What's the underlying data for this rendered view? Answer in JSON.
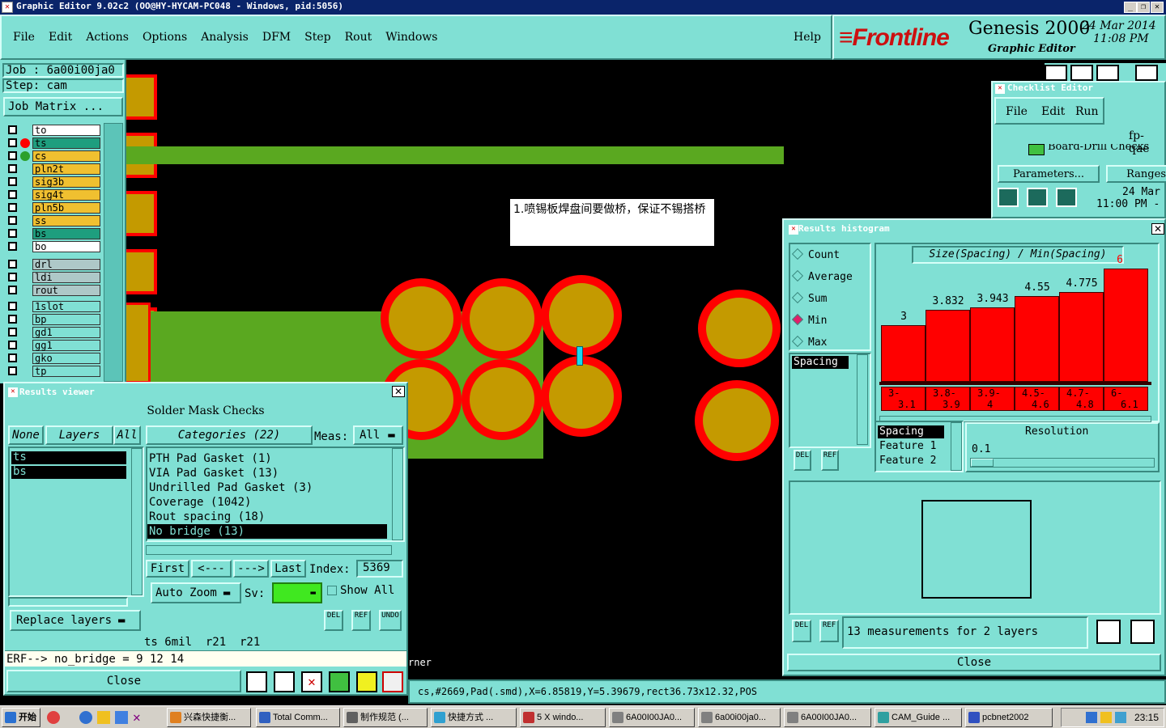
{
  "window": {
    "title": "Graphic Editor 9.02c2  (OO@HY-HYCAM-PC048 - Windows, pid:5056)"
  },
  "menu": [
    "File",
    "Edit",
    "Actions",
    "Options",
    "Analysis",
    "DFM",
    "Step",
    "Rout",
    "Windows"
  ],
  "help_label": "Help",
  "brand": {
    "logo": "Frontline",
    "product": "Genesis 2000",
    "subtitle": "Graphic Editor",
    "date": "24 Mar 2014",
    "time": "11:08 PM"
  },
  "job": {
    "job_line": "Job :  6a00i00ja0",
    "step_line": "Step:  cam",
    "matrix_button": "Job Matrix ..."
  },
  "layers": [
    {
      "name": "to",
      "color": "#ffffff",
      "dot": ""
    },
    {
      "name": "ts",
      "color": "#1e9e7e",
      "dot": "#ff0000"
    },
    {
      "name": "cs",
      "color": "#f0c030",
      "dot": "#2ca02c"
    },
    {
      "name": "pln2t",
      "color": "#f0c030",
      "dot": ""
    },
    {
      "name": "sig3b",
      "color": "#f0c030",
      "dot": ""
    },
    {
      "name": "sig4t",
      "color": "#f0c030",
      "dot": ""
    },
    {
      "name": "pln5b",
      "color": "#f0c030",
      "dot": ""
    },
    {
      "name": "ss",
      "color": "#f0c030",
      "dot": ""
    },
    {
      "name": "bs",
      "color": "#1e9e7e",
      "dot": ""
    },
    {
      "name": "bo",
      "color": "#ffffff",
      "dot": ""
    },
    {
      "name": "drl",
      "color": "#aec8c8",
      "dot": ""
    },
    {
      "name": "ldi",
      "color": "#aec8c8",
      "dot": ""
    },
    {
      "name": "rout",
      "color": "#aec8c8",
      "dot": ""
    },
    {
      "name": "1slot",
      "color": "#80e0d4",
      "dot": ""
    },
    {
      "name": "bp",
      "color": "#80e0d4",
      "dot": ""
    },
    {
      "name": "gd1",
      "color": "#80e0d4",
      "dot": ""
    },
    {
      "name": "gg1",
      "color": "#80e0d4",
      "dot": ""
    },
    {
      "name": "gko",
      "color": "#80e0d4",
      "dot": ""
    },
    {
      "name": "tp",
      "color": "#80e0d4",
      "dot": ""
    }
  ],
  "annotation": "1.喷锡板焊盘间要做桥，保证不锡搭桥",
  "results_viewer": {
    "title": "Results viewer",
    "heading": "Solder Mask Checks",
    "none_btn": "None",
    "layers_btn": "Layers",
    "all_btn": "All",
    "categories_btn": "Categories (22)",
    "meas_label": "Meas:",
    "meas_value": "All",
    "layer_list": [
      "ts",
      "bs"
    ],
    "categories": [
      "PTH Pad Gasket (1)",
      "VIA Pad Gasket (13)",
      "Undrilled Pad Gasket (3)",
      "Coverage (1042)",
      "Rout spacing (18)",
      "No bridge (13)"
    ],
    "first_btn": "First",
    "prev_btn": "<---",
    "next_btn": "--->",
    "last_btn": "Last",
    "index_label": "Index:",
    "index_value": "5369",
    "auto_zoom": "Auto Zoom",
    "sv_label": "Sv:",
    "show_all": "Show All",
    "replace_layers": "Replace layers",
    "status_line": "ts 6mil  r21  r21",
    "erf_line": "ERF--> no_bridge = 9 12 14",
    "close": "Close",
    "del": "DEL",
    "ref": "REF",
    "undo": "UNDO"
  },
  "checklist": {
    "title": "Checklist Editor",
    "menu": [
      "File",
      "Edit",
      "Run"
    ],
    "name": "fp-qae",
    "row": "Board-Drill Checks",
    "params_btn": "Parameters...",
    "ranges_btn": "Ranges",
    "date": "24 Mar",
    "time": "11:00 PM -"
  },
  "histogram": {
    "title": "Results histogram",
    "modes": [
      {
        "label": "Count",
        "selected": false
      },
      {
        "label": "Average",
        "selected": false
      },
      {
        "label": "Sum",
        "selected": false
      },
      {
        "label": "Min",
        "selected": true
      },
      {
        "label": "Max",
        "selected": false
      }
    ],
    "list_item": "Spacing",
    "chart_title": "Size(Spacing) / Min(Spacing)",
    "bar_max": 6,
    "chart_data": {
      "type": "bar",
      "title": "Size(Spacing) / Min(Spacing)",
      "categories": [
        "3-3.1",
        "3.8-3.9",
        "3.9-4",
        "4.5-4.6",
        "4.7-4.8",
        "6-6.1"
      ],
      "values": [
        3,
        3.832,
        3.943,
        4.55,
        4.775,
        6
      ]
    },
    "bar_labels": [
      "3",
      "3.832",
      "3.943",
      "4.55",
      "4.775",
      "6"
    ],
    "bin_top": [
      "3-",
      "3.8-",
      "3.9-",
      "4.5-",
      "4.7-",
      "6-"
    ],
    "bin_bottom": [
      "3.1",
      "3.9",
      "4",
      "4.6",
      "4.8",
      "6.1"
    ],
    "fields": [
      "Spacing",
      "Feature 1",
      "Feature 2"
    ],
    "resolution_label": "Resolution",
    "resolution_value": "0.1",
    "measure_text": "13 measurements for 2 layers",
    "close": "Close",
    "del": "DEL",
    "ref": "REF"
  },
  "status_bar": {
    "fragment": "rner",
    "info": "cs,#2669,Pad(.smd),X=6.85819,Y=5.39679,rect36.73x12.32,POS"
  },
  "taskbar": {
    "start": "开始",
    "buttons": [
      "兴森快捷衡...",
      "Total Comm...",
      "制作规范 (...",
      "快捷方式 ...",
      "5 X windo...",
      "6A00I00JA0...",
      "6a00i00ja0...",
      "6A00I00JA0...",
      "CAM_Guide ...",
      "pcbnet2002"
    ],
    "clock": "23:15"
  }
}
